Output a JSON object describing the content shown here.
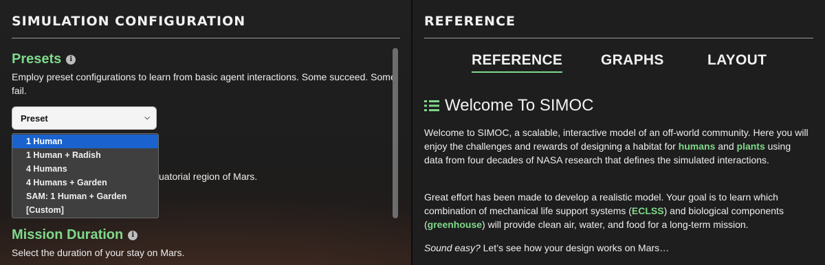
{
  "left_panel": {
    "title": "SIMULATION CONFIGURATION",
    "presets": {
      "heading": "Presets",
      "description": "Employ preset configurations to learn from basic agent interactions. Some succeed. Some fail.",
      "select_value": "Preset",
      "options": [
        "1 Human",
        "1 Human + Radish",
        "4 Humans",
        "4 Humans + Garden",
        "SAM: 1 Human + Garden",
        "[Custom]"
      ],
      "selected_option": "1 Human"
    },
    "hidden_text_fragment": "uatorial region of Mars.",
    "mission_duration": {
      "heading": "Mission Duration",
      "description": "Select the duration of your stay on Mars."
    }
  },
  "right_panel": {
    "title": "REFERENCE",
    "tabs": [
      {
        "label": "REFERENCE",
        "active": true
      },
      {
        "label": "GRAPHS",
        "active": false
      },
      {
        "label": "LAYOUT",
        "active": false
      }
    ],
    "welcome_heading": "Welcome To SIMOC",
    "p1": {
      "a": "Welcome to SIMOC, a scalable, interactive model of an off-world community. Here you will enjoy the challenges and rewards of designing a habitat for ",
      "humans": "humans",
      "b": " and ",
      "plants": "plants",
      "c": " using data from four decades of NASA research that defines the simulated interactions."
    },
    "p2": {
      "a": "Great effort has been made to develop a realistic model. Your goal is to learn which combination of mechanical life support systems (",
      "eclss": "ECLSS",
      "b": ") and biological components (",
      "greenhouse": "greenhouse",
      "c": ") will provide clean air, water, and food for a long-term mission."
    },
    "p3": {
      "italic": "Sound easy?",
      "rest": " Let’s see how your design works on Mars…"
    }
  },
  "colors": {
    "accent_green": "#7fd98b",
    "selected_option_blue": "#1a63cf"
  }
}
